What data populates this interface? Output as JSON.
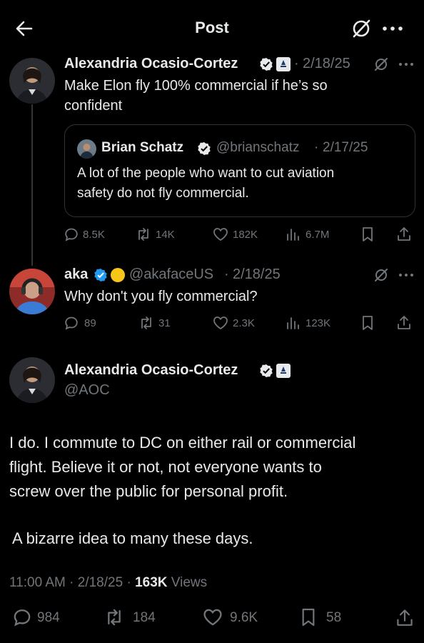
{
  "header": {
    "title": "Post"
  },
  "tweet1": {
    "author": "Alexandria Ocasio-Cortez",
    "date": "2/18/25",
    "text_line1": "Make Elon fly 100% commercial if he’s so",
    "text_line2": "confident",
    "stats": {
      "replies": "8.5K",
      "retweets": "14K",
      "likes": "182K",
      "views": "6.7M"
    }
  },
  "quote": {
    "author": "Brian Schatz",
    "handle": "@brianschatz",
    "date": "2/17/25",
    "text_line1": "A lot of the people who want to cut aviation",
    "text_line2": "safety do not fly commercial."
  },
  "tweet2": {
    "author": "aka",
    "handle": "@akafaceUS",
    "date": "2/18/25",
    "text": "Why don't you fly commercial?",
    "stats": {
      "replies": "89",
      "retweets": "31",
      "likes": "2.3K",
      "views": "123K"
    }
  },
  "main": {
    "author": "Alexandria Ocasio-Cortez",
    "handle": "@AOC",
    "para1_line1": "I do. I commute to DC on either rail or commercial",
    "para1_line2": "flight. Believe it or not, not everyone wants to",
    "para1_line3": "screw over the public for personal profit.",
    "para2": "A bizarre idea to many these days.",
    "time": "11:00 AM",
    "date": "2/18/25",
    "views_count": "163K",
    "views_label": "Views",
    "stats": {
      "replies": "984",
      "retweets": "184",
      "likes": "9.6K",
      "bookmarks": "58"
    }
  },
  "colors": {
    "background": "#000000",
    "text": "#e7e9ea",
    "muted": "#71767b",
    "verified": "#1d9bf0",
    "border": "#2f3336"
  }
}
